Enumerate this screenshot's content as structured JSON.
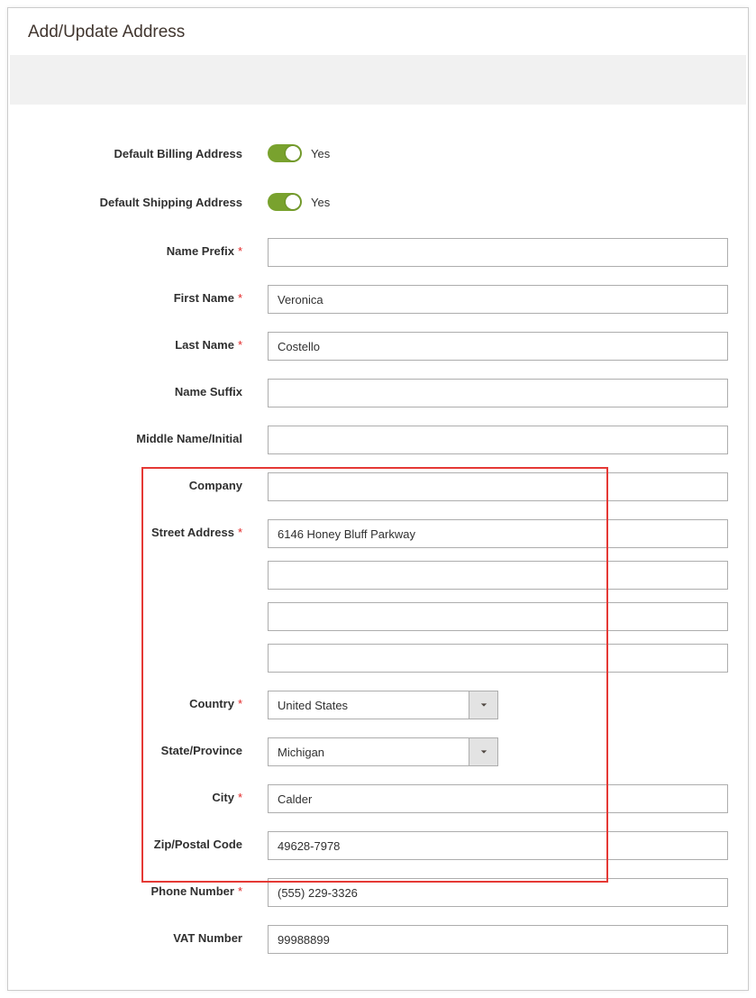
{
  "panel": {
    "title": "Add/Update Address"
  },
  "fields": {
    "default_billing": {
      "label": "Default Billing Address",
      "state_text": "Yes"
    },
    "default_shipping": {
      "label": "Default Shipping Address",
      "state_text": "Yes"
    },
    "prefix": {
      "label": "Name Prefix",
      "required": true,
      "value": ""
    },
    "first_name": {
      "label": "First Name",
      "required": true,
      "value": "Veronica"
    },
    "last_name": {
      "label": "Last Name",
      "required": true,
      "value": "Costello"
    },
    "suffix": {
      "label": "Name Suffix",
      "required": false,
      "value": ""
    },
    "middle": {
      "label": "Middle Name/Initial",
      "required": false,
      "value": ""
    },
    "company": {
      "label": "Company",
      "required": false,
      "value": ""
    },
    "street": {
      "label": "Street Address",
      "required": true,
      "lines": [
        "6146 Honey Bluff Parkway",
        "",
        "",
        ""
      ]
    },
    "country": {
      "label": "Country",
      "required": true,
      "selected": "United States"
    },
    "state": {
      "label": "State/Province",
      "required": false,
      "selected": "Michigan"
    },
    "city": {
      "label": "City",
      "required": true,
      "value": "Calder"
    },
    "zip": {
      "label": "Zip/Postal Code",
      "required": false,
      "value": "49628-7978"
    },
    "phone": {
      "label": "Phone Number",
      "required": true,
      "value": "(555) 229-3326"
    },
    "vat": {
      "label": "VAT Number",
      "required": false,
      "value": "99988899"
    }
  }
}
